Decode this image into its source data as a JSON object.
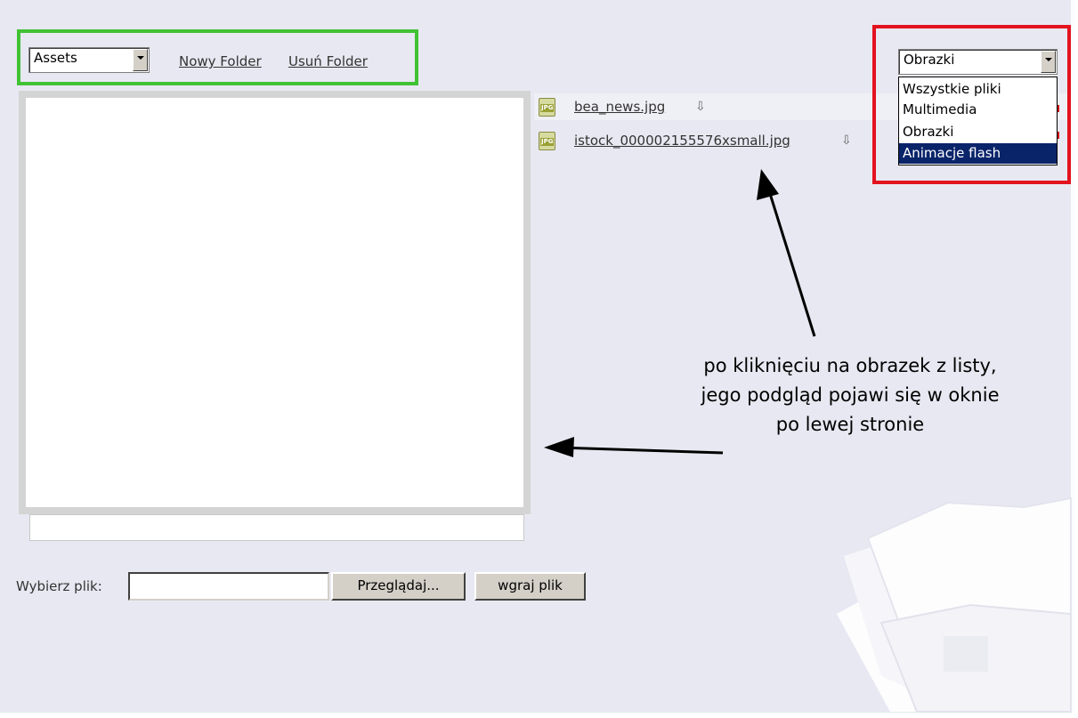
{
  "folder_bar": {
    "folder_select_value": "Assets",
    "new_folder_label": "Nowy Folder",
    "delete_folder_label": "Usuń Folder"
  },
  "filter": {
    "selected": "Obrazki",
    "options": [
      "Wszystkie pliki",
      "Multimedia",
      "Obrazki",
      "Animacje flash"
    ],
    "highlighted_option": "Animacje flash"
  },
  "files": [
    {
      "name": "bea_news.jpg",
      "icon": "jpg-file-icon"
    },
    {
      "name": "istock_000002155576xsmall.jpg",
      "icon": "jpg-file-icon"
    }
  ],
  "jpg_icon_text": "JPG",
  "download_glyph": "⇩",
  "annotation": {
    "lines": [
      "po kliknięciu na obrazek z listy,",
      "jego podgląd pojawi się w oknie",
      "po lewej stronie"
    ]
  },
  "upload": {
    "label": "Wybierz plik:",
    "input_value": "",
    "browse_label": "Przeglądaj...",
    "upload_label": "wgraj plik"
  },
  "colors": {
    "background": "#e8e8f2",
    "green_highlight": "#41c234",
    "red_highlight": "#e3121f",
    "selected_option": "#0a246a"
  }
}
